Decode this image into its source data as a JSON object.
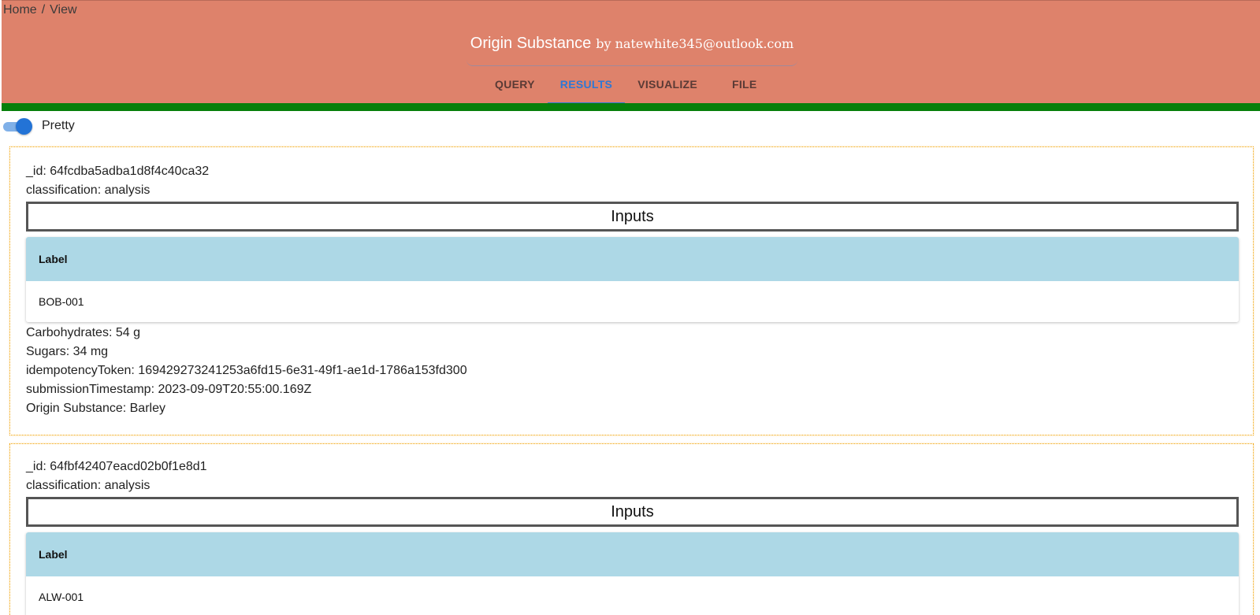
{
  "breadcrumb": {
    "home": "Home",
    "separator": "/",
    "current": "View"
  },
  "header": {
    "title": "Origin Substance",
    "by_text": "by natewhite345@outlook.com"
  },
  "tabs": [
    {
      "label": "QUERY",
      "active": false
    },
    {
      "label": "RESULTS",
      "active": true
    },
    {
      "label": "VISUALIZE",
      "active": false
    },
    {
      "label": "FILE",
      "active": false
    }
  ],
  "toggle": {
    "label": "Pretty",
    "on": true
  },
  "colors": {
    "header_bg": "#de826b",
    "green_bar": "#067f0a",
    "accent": "#2f78d4",
    "table_header": "#add8e6",
    "record_border": "#f0a000"
  },
  "records": [
    {
      "id_line": "_id: 64fcdba5adba1d8f4c40ca32",
      "classification_line": "classification: analysis",
      "inputs_title": "Inputs",
      "table_header": "Label",
      "table_value": "BOB-001",
      "fields": [
        "Carbohydrates: 54 g",
        "Sugars: 34 mg",
        "idempotencyToken: 169429273241253a6fd15-6e31-49f1-ae1d-1786a153fd300",
        "submissionTimestamp: 2023-09-09T20:55:00.169Z",
        "Origin Substance: Barley"
      ]
    },
    {
      "id_line": "_id: 64fbf42407eacd02b0f1e8d1",
      "classification_line": "classification: analysis",
      "inputs_title": "Inputs",
      "table_header": "Label",
      "table_value": "ALW-001",
      "fields": []
    }
  ]
}
